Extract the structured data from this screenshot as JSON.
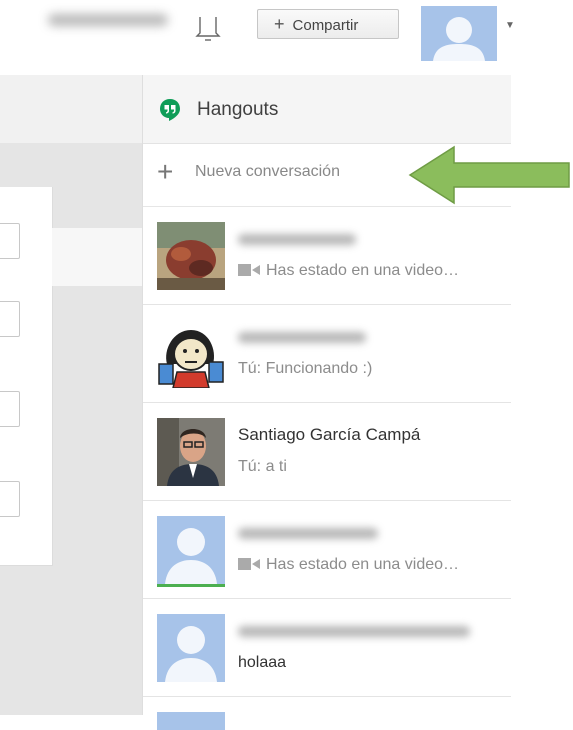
{
  "topbar": {
    "share_label": "Compartir"
  },
  "hangouts": {
    "title": "Hangouts",
    "new_conversation": "Nueva conversación",
    "conversations": [
      {
        "name": "",
        "message": "Has estado en una video…",
        "video": true,
        "online": false
      },
      {
        "name": "",
        "message": "Tú: Funcionando :)",
        "video": false,
        "online": false
      },
      {
        "name": "Santiago García Campá",
        "message": "Tú: a ti",
        "video": false,
        "online": false
      },
      {
        "name": "",
        "message": "Has estado en una video…",
        "video": true,
        "online": true
      },
      {
        "name": "",
        "message": "holaaa",
        "video": false,
        "online": false
      }
    ]
  },
  "colors": {
    "hangouts_green": "#0f9d58",
    "arrow_green": "#8bbd5c",
    "avatar_blue": "#a7c3e9",
    "online_green": "#4caf50"
  },
  "icons": {
    "bell": "bell-icon",
    "plus": "plus-icon",
    "video": "video-camera-icon",
    "logo": "hangouts-logo-icon"
  }
}
